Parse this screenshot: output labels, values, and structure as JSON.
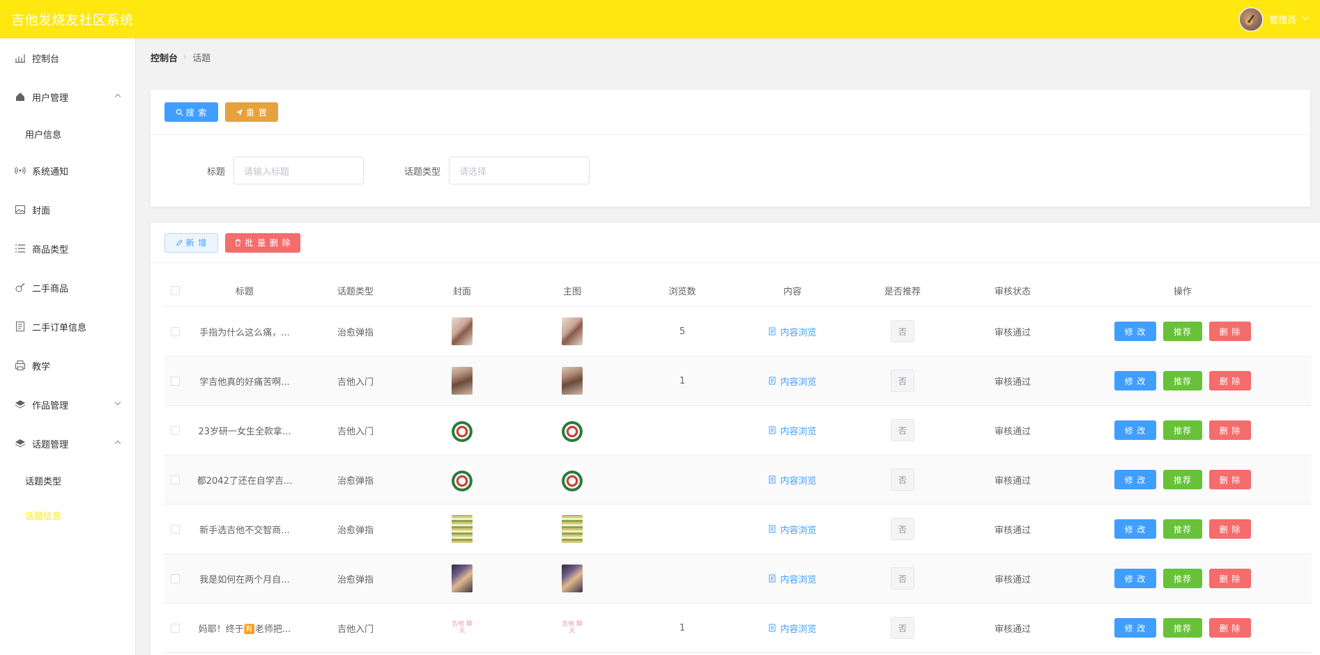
{
  "app": {
    "title": "吉他发烧友社区系统",
    "user_label": "管理员"
  },
  "sidebar": {
    "items": [
      {
        "label": "控制台",
        "icon": "chart-icon"
      },
      {
        "label": "用户管理",
        "icon": "home-icon",
        "expanded": true,
        "children": [
          {
            "label": "用户信息"
          }
        ]
      },
      {
        "label": "系统通知",
        "icon": "broadcast-icon"
      },
      {
        "label": "封面",
        "icon": "picture-icon"
      },
      {
        "label": "商品类型",
        "icon": "list-icon"
      },
      {
        "label": "二手商品",
        "icon": "guitar-icon"
      },
      {
        "label": "二手订单信息",
        "icon": "document-icon"
      },
      {
        "label": "教学",
        "icon": "printer-icon"
      },
      {
        "label": "作品管理",
        "icon": "layers-icon",
        "expanded": false
      },
      {
        "label": "话题管理",
        "icon": "layers-icon",
        "expanded": true,
        "children": [
          {
            "label": "话题类型"
          },
          {
            "label": "话题信息",
            "active": true
          }
        ]
      }
    ]
  },
  "breadcrumb": {
    "home": "控制台",
    "current": "话题"
  },
  "search": {
    "search_label": "搜 索",
    "reset_label": "重 置",
    "title_label": "标题",
    "title_placeholder": "请输入标题",
    "type_label": "话题类型",
    "type_placeholder": "请选择"
  },
  "toolbar": {
    "add_label": "新 增",
    "batch_delete_label": "批 量 删 除"
  },
  "table": {
    "headers": [
      "标题",
      "话题类型",
      "封面",
      "主图",
      "浏览数",
      "内容",
      "是否推荐",
      "审核状态",
      "操作"
    ],
    "rows": [
      {
        "title": "手指为什么这么痛，...",
        "type": "治愈弹指",
        "views": "5",
        "content": "内容浏览",
        "recommend": "否",
        "status": "审核通过"
      },
      {
        "title": " 学吉他真的好痛苦啊...",
        "type": "吉他入门",
        "views": "1",
        "content": "内容浏览",
        "recommend": "否",
        "status": "审核通过"
      },
      {
        "title": "23岁研一女生全款拿...",
        "type": "吉他入门",
        "views": "",
        "content": "内容浏览",
        "recommend": "否",
        "status": "审核通过"
      },
      {
        "title": "都2042了还在自学吉...",
        "type": "治愈弹指",
        "views": "",
        "content": "内容浏览",
        "recommend": "否",
        "status": "审核通过"
      },
      {
        "title": "新手选吉他不交智商...",
        "type": "治愈弹指",
        "views": "",
        "content": "内容浏览",
        "recommend": "否",
        "status": "审核通过"
      },
      {
        "title": "我是如何在两个月自...",
        "type": "治愈弹指",
        "views": "",
        "content": "内容浏览",
        "recommend": "否",
        "status": "审核通过"
      },
      {
        "title": "妈耶！终于🈶老师把...",
        "type": "吉他入门",
        "views": "1",
        "content": "内容浏览",
        "recommend": "否",
        "status": "审核通过"
      }
    ],
    "ops": {
      "edit": "修 改",
      "recommend": "推荐",
      "delete": "删 除"
    },
    "thumb_text": "吉他 聊天"
  },
  "colors": {
    "header": "#ffe70f",
    "primary": "#409eff",
    "warning": "#e6a23c",
    "success": "#67c23a",
    "danger": "#f56c6c"
  }
}
